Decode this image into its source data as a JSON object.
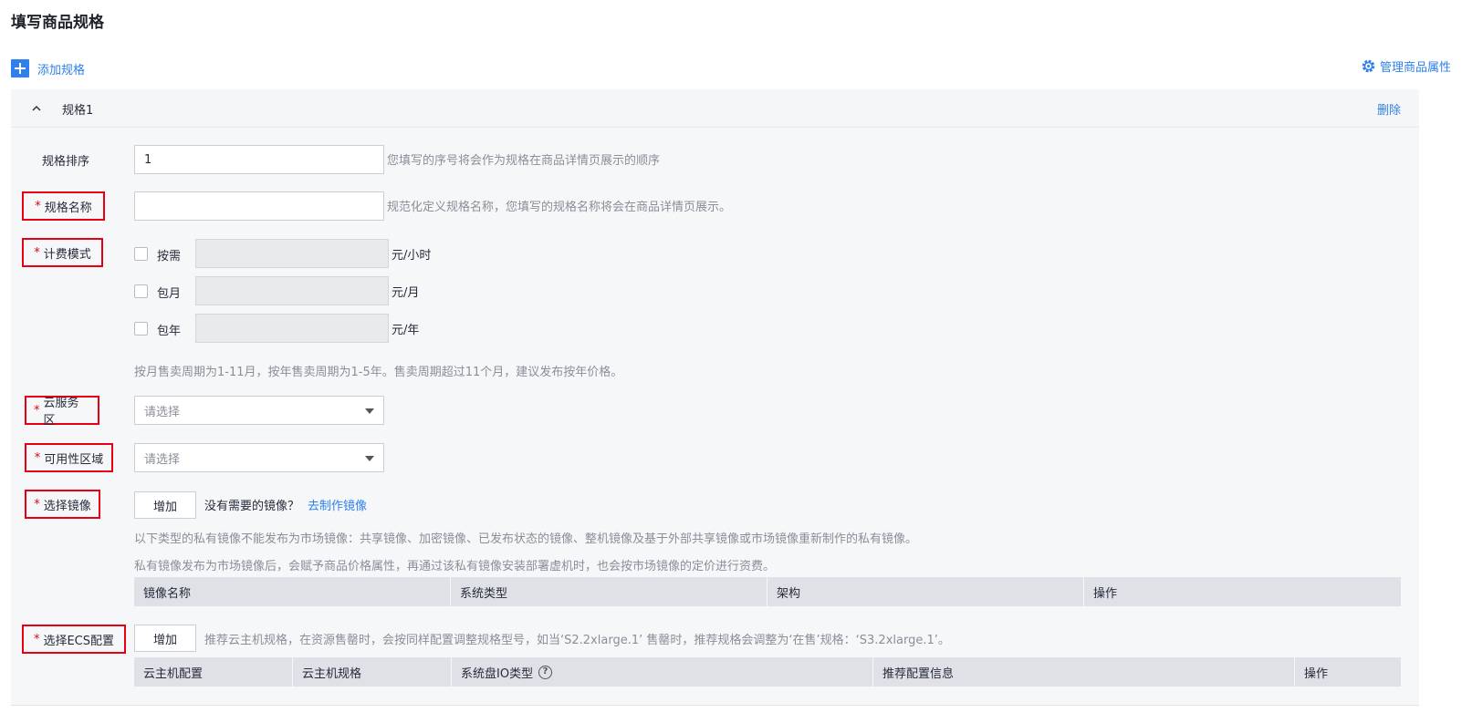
{
  "page": {
    "title": "填写商品规格"
  },
  "toolbar": {
    "add_spec_label": "添加规格",
    "manage_attr_label": "管理商品属性"
  },
  "panel": {
    "title": "规格1",
    "delete_label": "删除",
    "sort": {
      "label": "规格排序",
      "value": "1",
      "hint": "您填写的序号将会作为规格在商品详情页展示的顺序"
    },
    "name": {
      "label": "规格名称",
      "value": "",
      "hint": "规范化定义规格名称，您填写的规格名称将会在商品详情页展示。"
    },
    "billing": {
      "label": "计费模式",
      "options": [
        {
          "label": "按需",
          "unit": "元/小时",
          "checked": false
        },
        {
          "label": "包月",
          "unit": "元/月",
          "checked": false
        },
        {
          "label": "包年",
          "unit": "元/年",
          "checked": false
        }
      ],
      "hint": "按月售卖周期为1-11月，按年售卖周期为1-5年。售卖周期超过11个月，建议发布按年价格。"
    },
    "region": {
      "label": "云服务区",
      "placeholder": "请选择"
    },
    "az": {
      "label": "可用性区域",
      "placeholder": "请选择"
    },
    "image": {
      "label": "选择镜像",
      "add_label": "增加",
      "no_image_text": "没有需要的镜像？",
      "make_image_link": "去制作镜像",
      "note1": "以下类型的私有镜像不能发布为市场镜像：共享镜像、加密镜像、已发布状态的镜像、整机镜像及基于外部共享镜像或市场镜像重新制作的私有镜像。",
      "note2": "私有镜像发布为市场镜像后，会赋予商品价格属性，再通过该私有镜像安装部署虚机时，也会按市场镜像的定价进行资费。",
      "columns": [
        "镜像名称",
        "系统类型",
        "架构",
        "操作"
      ]
    },
    "ecs": {
      "label": "选择ECS配置",
      "add_label": "增加",
      "hint": "推荐云主机规格，在资源售罄时，会按同样配置调整规格型号，如当‘S2.2xlarge.1’ 售罄时，推荐规格会调整为‘在售’规格：‘S3.2xlarge.1’。",
      "columns": [
        "云主机配置",
        "云主机规格",
        "系统盘IO类型",
        "推荐配置信息",
        "操作"
      ]
    }
  },
  "colors": {
    "accent": "#2f80ed",
    "required": "#e60012"
  }
}
